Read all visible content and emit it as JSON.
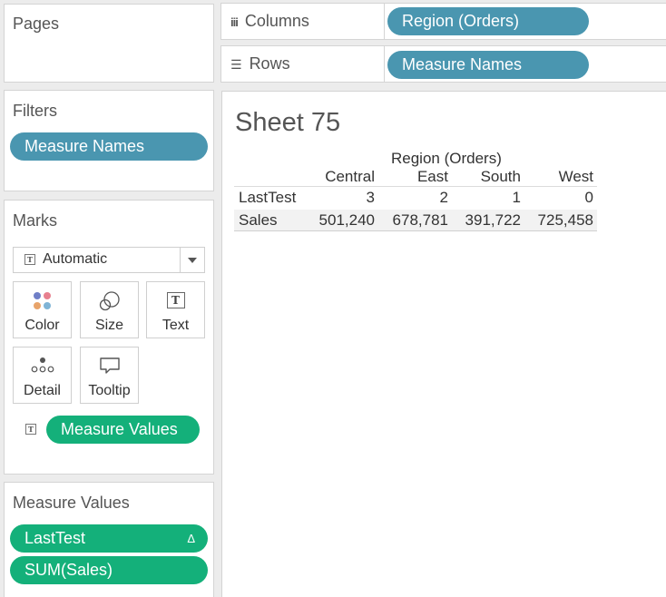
{
  "pages": {
    "title": "Pages"
  },
  "shelves": {
    "columns": {
      "label": "Columns",
      "pill": "Region (Orders)"
    },
    "rows": {
      "label": "Rows",
      "pill": "Measure Names"
    }
  },
  "filters": {
    "title": "Filters",
    "pills": [
      "Measure Names"
    ]
  },
  "marks": {
    "title": "Marks",
    "mark_type": "Automatic",
    "buttons": {
      "color": "Color",
      "size": "Size",
      "text": "Text",
      "detail": "Detail",
      "tooltip": "Tooltip"
    },
    "text_pill": "Measure Values"
  },
  "measure_values": {
    "title": "Measure Values",
    "pills": [
      {
        "label": "LastTest",
        "badge": "Δ"
      },
      {
        "label": "SUM(Sales)"
      }
    ]
  },
  "sheet": {
    "title": "Sheet 75",
    "column_header": "Region (Orders)",
    "columns": [
      "Central",
      "East",
      "South",
      "West"
    ],
    "rows": [
      {
        "name": "LastTest",
        "values": [
          "3",
          "2",
          "1",
          "0"
        ]
      },
      {
        "name": "Sales",
        "values": [
          "501,240",
          "678,781",
          "391,722",
          "725,458"
        ]
      }
    ]
  },
  "colors": {
    "blue_pill": "#4a96b0",
    "green_pill": "#14b07a",
    "background": "#ececec"
  }
}
